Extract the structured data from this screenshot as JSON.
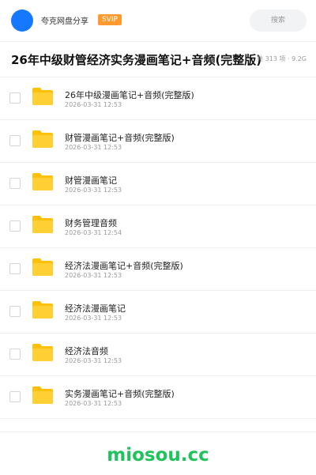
{
  "header": {
    "app_name": "夸克网盘分享",
    "badge": "SVIP",
    "search_placeholder": "搜索"
  },
  "title_bar": {
    "title": "26年中级财管经济实务漫画笔记+音频(完整版)",
    "meta": "共 313 项 · 9.2G"
  },
  "files": [
    {
      "name": "26年中级漫画笔记+音频(完整版)",
      "date": "2026-03-31 12:53"
    },
    {
      "name": "财管漫画笔记+音频(完整版)",
      "date": "2026-03-31 12:53"
    },
    {
      "name": "财管漫画笔记",
      "date": "2026-03-31 12:53"
    },
    {
      "name": "财务管理音频",
      "date": "2026-03-31 12:54"
    },
    {
      "name": "经济法漫画笔记+音频(完整版)",
      "date": "2026-03-31 12:53"
    },
    {
      "name": "经济法漫画笔记",
      "date": "2026-03-31 12:53"
    },
    {
      "name": "经济法音频",
      "date": "2026-03-31 12:53"
    },
    {
      "name": "实务漫画笔记+音频(完整版)",
      "date": "2026-03-31 12:53"
    }
  ],
  "footer": {
    "watermark": "miosou.cc"
  },
  "colors": {
    "accent_blue": "#1677ff",
    "badge_orange": "#ff9a2e",
    "folder_yellow": "#ffc107",
    "watermark_green": "#1ec35c"
  }
}
